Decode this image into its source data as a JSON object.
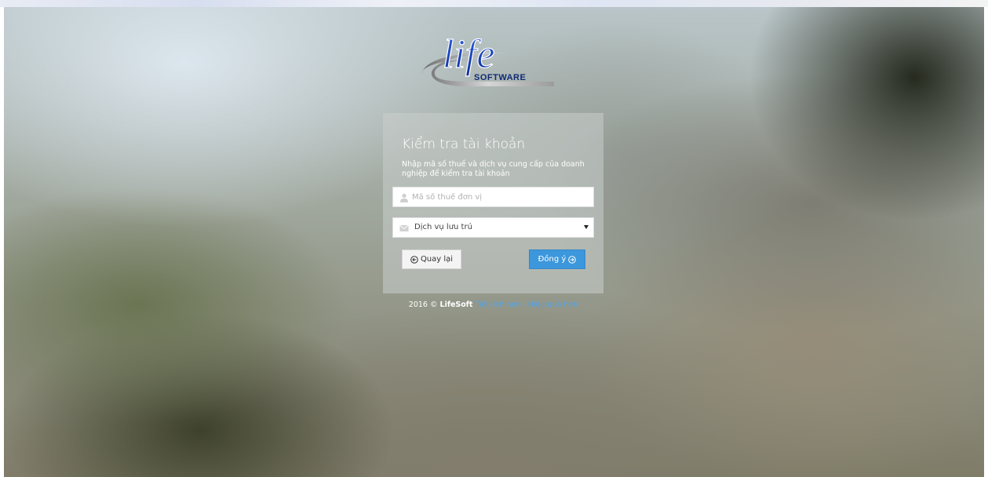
{
  "logo": {
    "word": "life",
    "sub": "SOFTWARE"
  },
  "form": {
    "title": "Kiểm tra tài khoản",
    "subtitle": "Nhập mã số thuế và dịch vụ cung cấp của doanh nghiệp để kiểm tra tài khoản",
    "tax_field": {
      "placeholder": "Mã số thuế đơn vị",
      "value": "",
      "icon": "user-icon"
    },
    "service_select": {
      "selected": "Dịch vụ lưu trú",
      "icon": "envelope-icon"
    },
    "back_button": {
      "label": "Quay lại",
      "icon": "circle-arrow-left-icon"
    },
    "ok_button": {
      "label": "Đồng ý",
      "icon": "circle-arrow-right-icon"
    }
  },
  "footer": {
    "year": "2016 ©",
    "brand": "LifeSoft",
    "tagline": "Tiện ích hơn - Hiệu quả hơn"
  },
  "colors": {
    "primary_button": "#3c97dc",
    "link": "#4fa3ea",
    "logo_blue": "#1e47c8",
    "logo_navy": "#0f2a73"
  }
}
